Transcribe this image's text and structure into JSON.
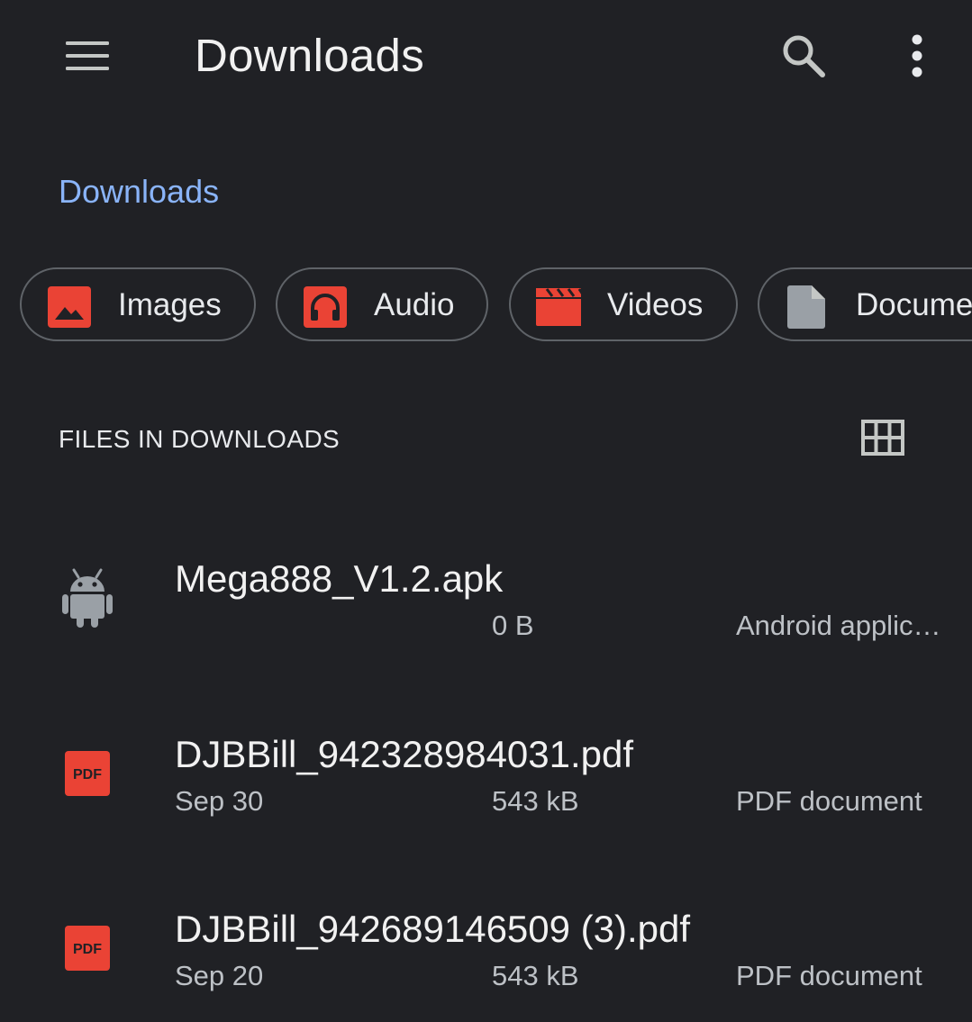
{
  "toolbar": {
    "menu_icon": "hamburger-menu-icon",
    "title": "Downloads",
    "search_icon": "search-icon",
    "more_icon": "more-vertical-icon"
  },
  "breadcrumb": {
    "label": "Downloads",
    "color": "#8ab4f8"
  },
  "chips": [
    {
      "label": "Images",
      "icon": "image-icon",
      "color": "#ea4335"
    },
    {
      "label": "Audio",
      "icon": "headphones-icon",
      "color": "#ea4335"
    },
    {
      "label": "Videos",
      "icon": "movie-clapper-icon",
      "color": "#ea4335"
    },
    {
      "label": "Docume",
      "icon": "document-icon",
      "color": "#9aa0a6"
    }
  ],
  "section": {
    "title": "FILES IN DOWNLOADS",
    "view_toggle_icon": "grid-view-icon"
  },
  "files": [
    {
      "name": "Mega888_V1.2.apk",
      "date": "",
      "size": "0 B",
      "type": "Android applic…",
      "icon": "android-icon"
    },
    {
      "name": "DJBBill_942328984031.pdf",
      "date": "Sep 30",
      "size": "543 kB",
      "type": "PDF document",
      "icon": "pdf-icon"
    },
    {
      "name": "DJBBill_942689146509 (3).pdf",
      "date": "Sep 20",
      "size": "543 kB",
      "type": "PDF document",
      "icon": "pdf-icon"
    }
  ],
  "colors": {
    "background": "#202125",
    "accent": "#8ab4f8",
    "icon_red": "#ea4335",
    "icon_gray": "#9aa0a6"
  }
}
